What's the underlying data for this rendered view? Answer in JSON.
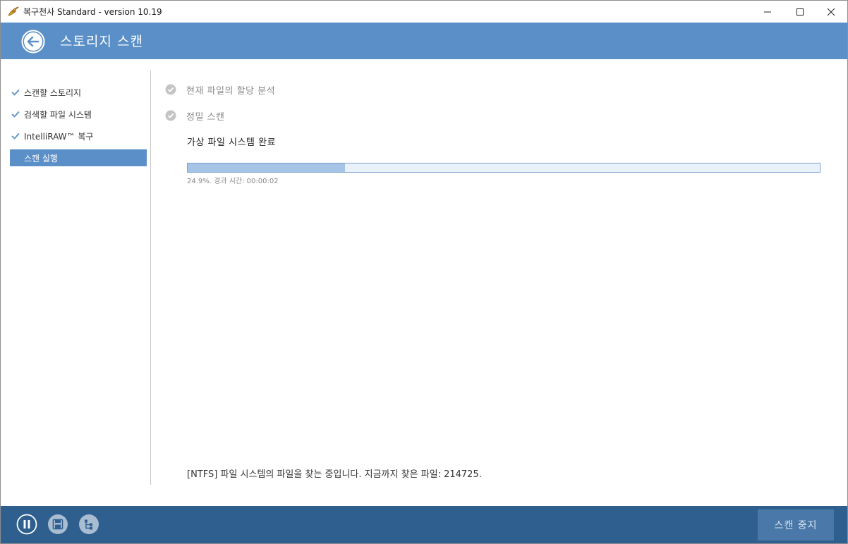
{
  "window": {
    "title": "복구천사 Standard - version 10.19"
  },
  "header": {
    "title": "스토리지 스캔"
  },
  "sidebar": {
    "items": [
      {
        "label": "스캔할 스토리지",
        "state": "done"
      },
      {
        "label": "검색할 파일 시스템",
        "state": "done"
      },
      {
        "label": "IntelliRAW™ 복구",
        "state": "done"
      },
      {
        "label": "스캔 실행",
        "state": "active"
      }
    ]
  },
  "steps": [
    {
      "label": "현재 파일의 할당 분석",
      "state": "done"
    },
    {
      "label": "정밀 스캔",
      "state": "done"
    }
  ],
  "current_step": "가상 파일 시스템 완료",
  "progress": {
    "fraction": 0.249,
    "text": "24.9%. 경과 시간: 00:00:02"
  },
  "status_line": "[NTFS] 파일 시스템의 파일을 찾는 중입니다. 지금까지 찾은 파일: 214725.",
  "footer": {
    "icons": [
      "pause-icon",
      "save-icon",
      "tree-view-icon"
    ],
    "stop_button_label": "스캔 중지"
  },
  "colors": {
    "header_bg": "#5a8fc7",
    "footer_bg": "#2f5f8e",
    "active_item": "#5a8fc7",
    "progress_fill": "#a5c4e6"
  }
}
